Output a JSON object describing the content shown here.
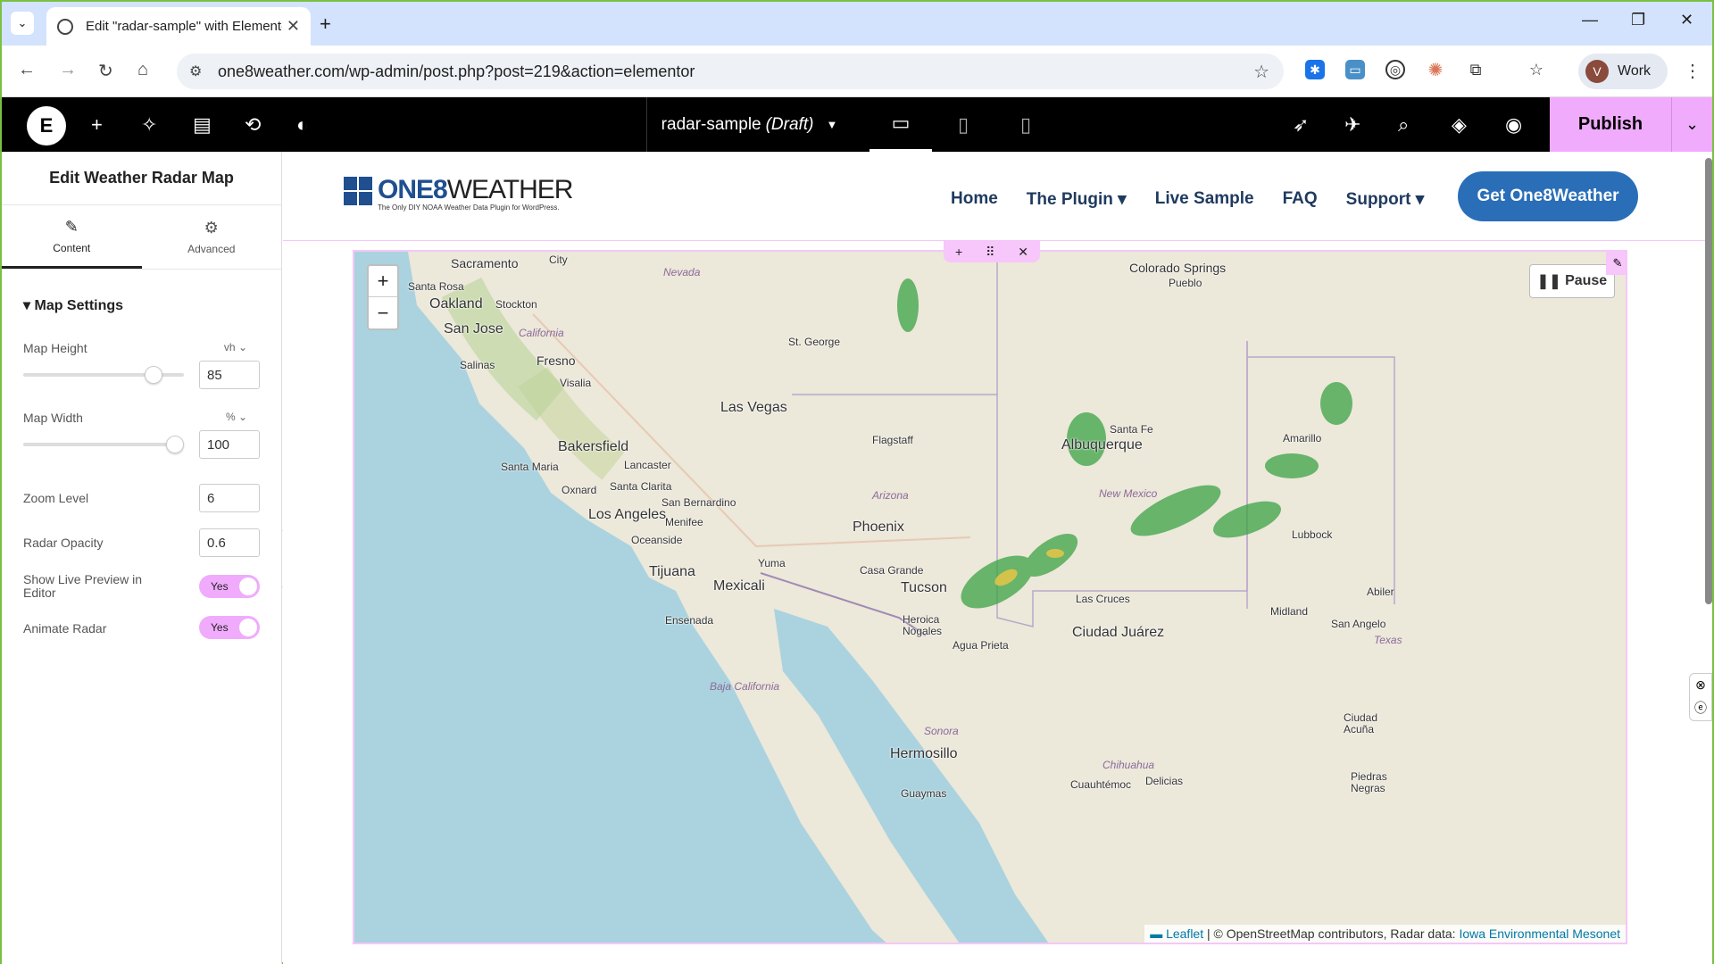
{
  "browser": {
    "tab_title": "Edit \"radar-sample\" with Elementor",
    "url": "one8weather.com/wp-admin/post.php?post=219&action=elementor",
    "profile_initial": "V",
    "profile_name": "Work"
  },
  "editor": {
    "document_name": "radar-sample",
    "document_status": "(Draft)",
    "publish_label": "Publish"
  },
  "panel": {
    "title": "Edit Weather Radar Map",
    "tabs": [
      {
        "label": "Content"
      },
      {
        "label": "Advanced"
      }
    ],
    "section_title": "Map Settings",
    "map_height": {
      "label": "Map Height",
      "unit": "vh",
      "value": "85",
      "fraction": 0.85
    },
    "map_width": {
      "label": "Map Width",
      "unit": "%",
      "value": "100",
      "fraction": 1.0
    },
    "zoom_level": {
      "label": "Zoom Level",
      "value": "6"
    },
    "radar_opacity": {
      "label": "Radar Opacity",
      "value": "0.6"
    },
    "live_preview": {
      "label": "Show Live Preview in Editor",
      "value": "Yes"
    },
    "animate_radar": {
      "label": "Animate Radar",
      "value": "Yes"
    }
  },
  "site": {
    "logo_main": "ONE8",
    "logo_accent": "WEATHER",
    "logo_tagline": "The Only DIY NOAA Weather Data Plugin for WordPress.",
    "menu": [
      "Home",
      "The Plugin ▾",
      "Live Sample",
      "FAQ",
      "Support ▾"
    ],
    "cta": "Get One8Weather"
  },
  "map": {
    "pause_label": "Pause",
    "attribution_leaflet": "Leaflet",
    "attribution_text": " | © OpenStreetMap contributors, Radar data: ",
    "attribution_link": "Iowa Environmental Mesonet",
    "cities": [
      "Sacramento",
      "City",
      "Santa Rosa",
      "Oakland",
      "Stockton",
      "San Jose",
      "Fresno",
      "Salinas",
      "Visalia",
      "St. George",
      "Las Vegas",
      "Flagstaff",
      "Bakersfield",
      "Santa Maria",
      "Lancaster",
      "Oxnard",
      "Santa Clarita",
      "Los Angeles",
      "San Bernardino",
      "Menifee",
      "Oceanside",
      "Tijuana",
      "Mexicali",
      "Yuma",
      "Ensenada",
      "Phoenix",
      "Casa Grande",
      "Tucson",
      "Heroica Nogales",
      "Agua Prieta",
      "Ciudad Juárez",
      "Las Cruces",
      "Albuquerque",
      "Santa Fe",
      "Colorado Springs",
      "Pueblo",
      "Amarillo",
      "Lubbock",
      "Midland",
      "San Angelo",
      "Abiler",
      "Ciudad Acuña",
      "Hermosillo",
      "Guaymas",
      "Cuauhtémoc",
      "Delicias",
      "Piedras Negras"
    ],
    "regions": [
      "Nevada",
      "California",
      "Arizona",
      "New Mexico",
      "Baja California",
      "Sonora",
      "Chihuahua",
      "Texas"
    ]
  },
  "colors": {
    "accent": "#f0abfc",
    "brand": "#2a6eb8",
    "water": "#aad3df",
    "land": "#ece8da"
  }
}
